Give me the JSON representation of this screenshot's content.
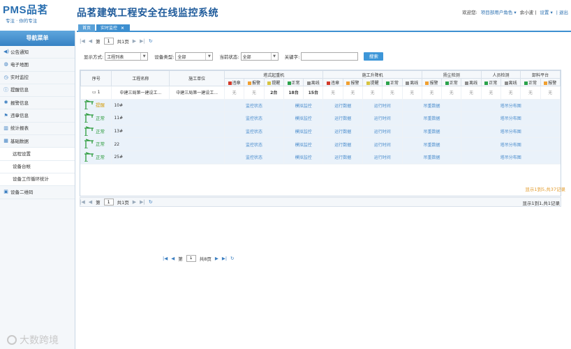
{
  "header": {
    "logo_text": "PMS品茗",
    "logo_sub": "专注 · 你的专注",
    "title": "品茗建筑工程安全在线监控系统",
    "welcome": "欢迎您:",
    "role": "项目部用户角色 ▾",
    "user": "余小波 |",
    "settings": "设置 ▾",
    "logout": "| 退出"
  },
  "tabs": [
    {
      "label": "首页"
    },
    {
      "label": "实时监控",
      "close": "×"
    }
  ],
  "sidebar": {
    "title": "导航菜单",
    "items": [
      {
        "label": "公告通知",
        "icon": "speaker-icon"
      },
      {
        "label": "电子地图",
        "icon": "globe-icon"
      },
      {
        "label": "实时监控",
        "icon": "clock-icon"
      },
      {
        "label": "提醒信息",
        "icon": "info-icon"
      },
      {
        "label": "报警信息",
        "icon": "alarm-icon"
      },
      {
        "label": "违章信息",
        "icon": "warning-icon"
      },
      {
        "label": "统计报表",
        "icon": "chart-icon"
      },
      {
        "label": "基础数据",
        "icon": "grid-icon"
      },
      {
        "label": "远程设置",
        "icon": "",
        "sub": true
      },
      {
        "label": "设备台帐",
        "icon": "",
        "sub": true
      },
      {
        "label": "设备工作循环统计",
        "icon": "",
        "sub": true
      },
      {
        "label": "设备二维码",
        "icon": "qr-icon"
      }
    ]
  },
  "pager_top": {
    "page_label": "第",
    "page": "1",
    "total": "共1页"
  },
  "filter": {
    "display_label": "显示方式:",
    "display_value": "工程列表",
    "type_label": "设备类型:",
    "type_value": "全部",
    "status_label": "当前状态:",
    "status_value": "全部",
    "keyword_label": "关键字:",
    "keyword_value": "",
    "search_btn": "搜索"
  },
  "table": {
    "h_index": "序号",
    "h_project": "工程名称",
    "h_unit": "施工单位",
    "groups": [
      "塔式起重机",
      "施工升降机",
      "扬尘检测",
      "人员检测",
      "卸料平台"
    ],
    "sub_tower": [
      "违章",
      "报警",
      "提醒",
      "正常",
      "离线"
    ],
    "sub_lift": [
      "违章",
      "报警",
      "提醒",
      "正常",
      "离线"
    ],
    "sub_dust": [
      "报警",
      "正常",
      "离线"
    ],
    "sub_people": [
      "正常",
      "离线"
    ],
    "sub_platform": [
      "正常",
      "报警"
    ],
    "colors": {
      "red": "#d23a2a",
      "orange": "#f0a030",
      "yellow": "#d6c340",
      "green": "#2aa24a",
      "gray": "#8c8c8c"
    },
    "summary": {
      "expander": "▭",
      "index": "1",
      "project": "中建三局第一建设工...",
      "unit": "中建三局第一建设工...",
      "values": [
        "无",
        "无",
        "2台",
        "18台",
        "15台",
        "无",
        "无",
        "无",
        "无",
        "无",
        "无",
        "无",
        "无",
        "无",
        "无",
        "无",
        "无"
      ]
    },
    "rows": [
      {
        "status": "提醒",
        "status_color": "#d4a21c",
        "name": "10#",
        "links": [
          "监控状态",
          "模拟监控",
          "运行数据",
          "运行时间",
          "吊重数据",
          "塔吊分布图"
        ]
      },
      {
        "status": "正常",
        "status_color": "#2a9a3a",
        "name": "11#",
        "links": [
          "监控状态",
          "模拟监控",
          "运行数据",
          "运行时间",
          "吊重数据",
          "塔吊分布图"
        ]
      },
      {
        "status": "正常",
        "status_color": "#2a9a3a",
        "name": "13#",
        "links": [
          "监控状态",
          "模拟监控",
          "运行数据",
          "运行时间",
          "吊重数据",
          "塔吊分布图"
        ]
      },
      {
        "status": "正常",
        "status_color": "#2a9a3a",
        "name": "22",
        "links": [
          "监控状态",
          "模拟监控",
          "运行数据",
          "运行时间",
          "吊重数据",
          "塔吊分布图"
        ]
      },
      {
        "status": "正常",
        "status_color": "#2a9a3a",
        "name": "25#",
        "links": [
          "监控状态",
          "模拟监控",
          "运行数据",
          "运行时间",
          "吊重数据",
          "塔吊分布图"
        ]
      }
    ]
  },
  "pager_inner": {
    "page_label": "第",
    "page": "1",
    "total": "共8页",
    "info": "显示1到5,共37记录"
  },
  "pager_bottom": {
    "page_label": "第",
    "page": "1",
    "total": "共1页",
    "info": "显示1到1,共1记录"
  },
  "watermark": "大数跨境"
}
